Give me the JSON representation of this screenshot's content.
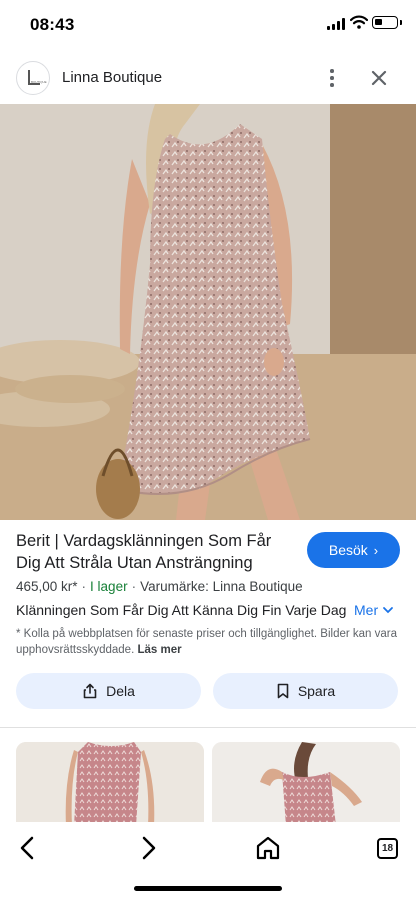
{
  "status_bar": {
    "time": "08:43"
  },
  "header": {
    "site_name": "Linna Boutique",
    "logo_text": "BOUTIQUE"
  },
  "product": {
    "title": "Berit | Vardagsklänningen Som Får Dig Att Stråla Utan Ansträngning",
    "price": "465,00 kr*",
    "stock": "I lager",
    "brand": "Varumärke: Linna Boutique",
    "description": "Klänningen Som Får Dig Att Känna Dig Fin Varje Dag",
    "more_label": "Mer",
    "disclaimer": "* Kolla på webbplatsen för senaste priser och tillgänglighet. Bilder kan vara upphovsrättsskyddade.",
    "read_more": "Läs mer"
  },
  "actions": {
    "visit_label": "Besök",
    "share_label": "Dela",
    "save_label": "Spara"
  },
  "bottom_nav": {
    "tabs_count": "18"
  },
  "colors": {
    "accent": "#1a73e8",
    "pill_bg": "#e8f0fe",
    "stock_green": "#188038"
  }
}
